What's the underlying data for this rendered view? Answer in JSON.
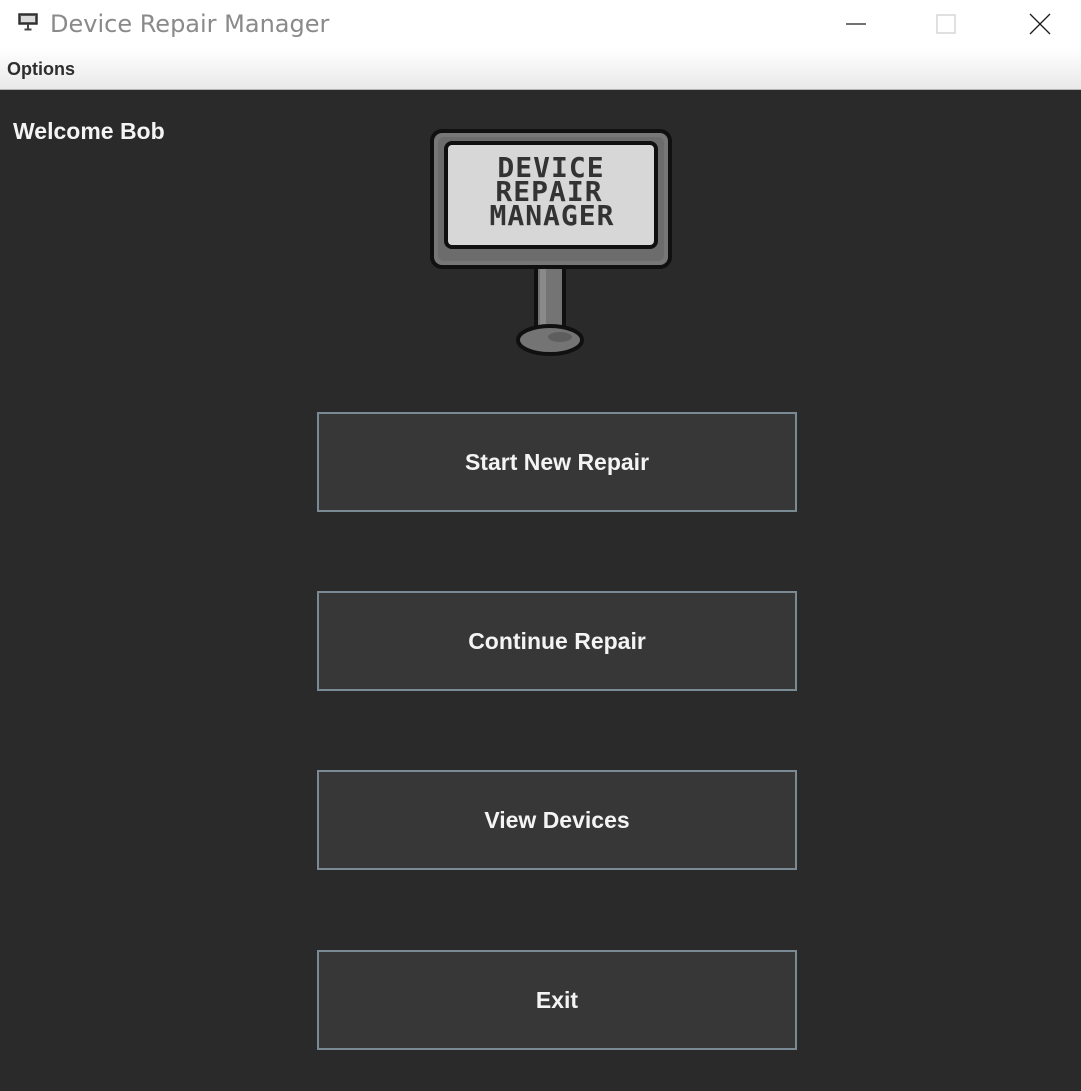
{
  "window": {
    "title": "Device Repair Manager",
    "icon": "signpost-icon",
    "controls": [
      "minimize-icon",
      "maximize-icon",
      "close-icon"
    ]
  },
  "menu": {
    "items": [
      "Options"
    ]
  },
  "main": {
    "welcome": "Welcome Bob",
    "logo": {
      "lines": [
        "DEVICE",
        "REPAIR",
        "MANAGER"
      ]
    },
    "buttons": [
      {
        "label": "Start New Repair"
      },
      {
        "label": "Continue Repair"
      },
      {
        "label": "View Devices"
      },
      {
        "label": "Exit"
      }
    ]
  },
  "colors": {
    "background": "#2a2a2a",
    "button_bg": "#373737",
    "button_border": "#7a8a94",
    "text": "#f4f4f4"
  }
}
